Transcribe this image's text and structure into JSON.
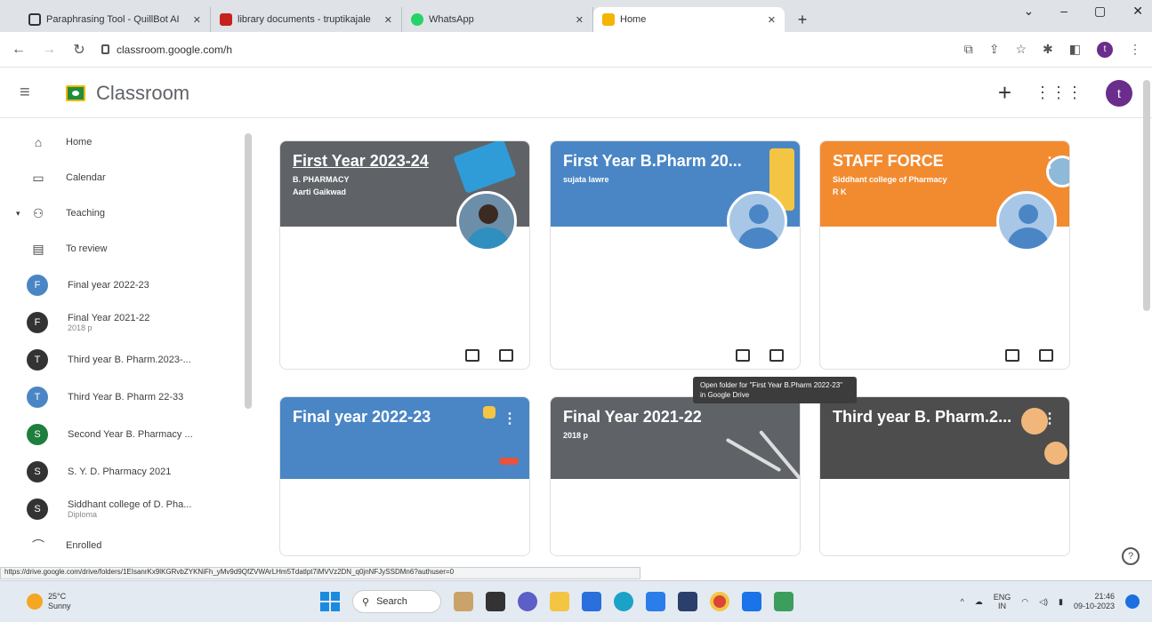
{
  "browser": {
    "tabs": [
      {
        "title": "Paraphrasing Tool - QuillBot AI",
        "color": "#333333"
      },
      {
        "title": "library documents - truptikajale",
        "color": "#c5221f"
      },
      {
        "title": "WhatsApp",
        "color": "#25d366"
      },
      {
        "title": "Home",
        "color": "#f4b400",
        "active": true
      }
    ],
    "url": "classroom.google.com/h"
  },
  "header": {
    "app_title": "Classroom",
    "avatar_letter": "t"
  },
  "sidebar": {
    "items": [
      {
        "label": "Home",
        "icon": "home-icon"
      },
      {
        "label": "Calendar",
        "icon": "calendar-icon"
      },
      {
        "label": "Teaching",
        "icon": "people-icon"
      },
      {
        "label": "To review",
        "icon": "review-folder-icon"
      }
    ],
    "classes": [
      {
        "letter": "F",
        "name": "Final year 2022-23",
        "sub": "",
        "color": "#4a86c5"
      },
      {
        "letter": "F",
        "name": "Final Year 2021-22",
        "sub": "2018 p",
        "color": "#333333"
      },
      {
        "letter": "T",
        "name": "Third year B. Pharm.2023-...",
        "sub": "",
        "color": "#333333"
      },
      {
        "letter": "T",
        "name": "Third Year B. Pharm 22-33",
        "sub": "",
        "color": "#4a86c5"
      },
      {
        "letter": "S",
        "name": "Second Year B. Pharmacy ...",
        "sub": "",
        "color": "#1e7e3e"
      },
      {
        "letter": "S",
        "name": "S. Y. D. Pharmacy 2021",
        "sub": "",
        "color": "#333333"
      },
      {
        "letter": "S",
        "name": "Siddhant college of D. Pha...",
        "sub": "Diploma",
        "color": "#333333"
      }
    ],
    "enrolled_label": "Enrolled"
  },
  "cards": [
    {
      "title": "First Year 2023-24",
      "section": "B. PHARMACY",
      "teacher": "Aarti Gaikwad",
      "color": "#5f6368"
    },
    {
      "title": "First Year B.Pharm 20...",
      "section": "",
      "teacher": "sujata lawre",
      "color": "#4a86c5"
    },
    {
      "title": "STAFF FORCE",
      "section": "Siddhant college of Pharmacy",
      "teacher": "R K",
      "color": "#f28b30"
    },
    {
      "title": "Final year 2022-23",
      "section": "",
      "teacher": "",
      "color": "#4a86c5"
    },
    {
      "title": "Final Year 2021-22",
      "section": "2018 p",
      "teacher": "",
      "color": "#5f6368"
    },
    {
      "title": "Third year B. Pharm.2...",
      "section": "",
      "teacher": "",
      "color": "#4d4d4d"
    }
  ],
  "tooltip": "Open folder for \"First Year B.Pharm 2022-23\" in Google Drive",
  "status_url": "https://drive.google.com/drive/folders/1EIsanrKx9lKGRvbZYKNiFh_yMv9d9QfZVWArLHm5Tdatlpt7iMVVz2DN_q0jnNFJySSDMn6?authuser=0",
  "taskbar": {
    "weather_temp": "25°C",
    "weather_desc": "Sunny",
    "search_label": "Search",
    "lang_top": "ENG",
    "lang_bottom": "IN",
    "time": "21:46",
    "date": "09-10-2023"
  }
}
